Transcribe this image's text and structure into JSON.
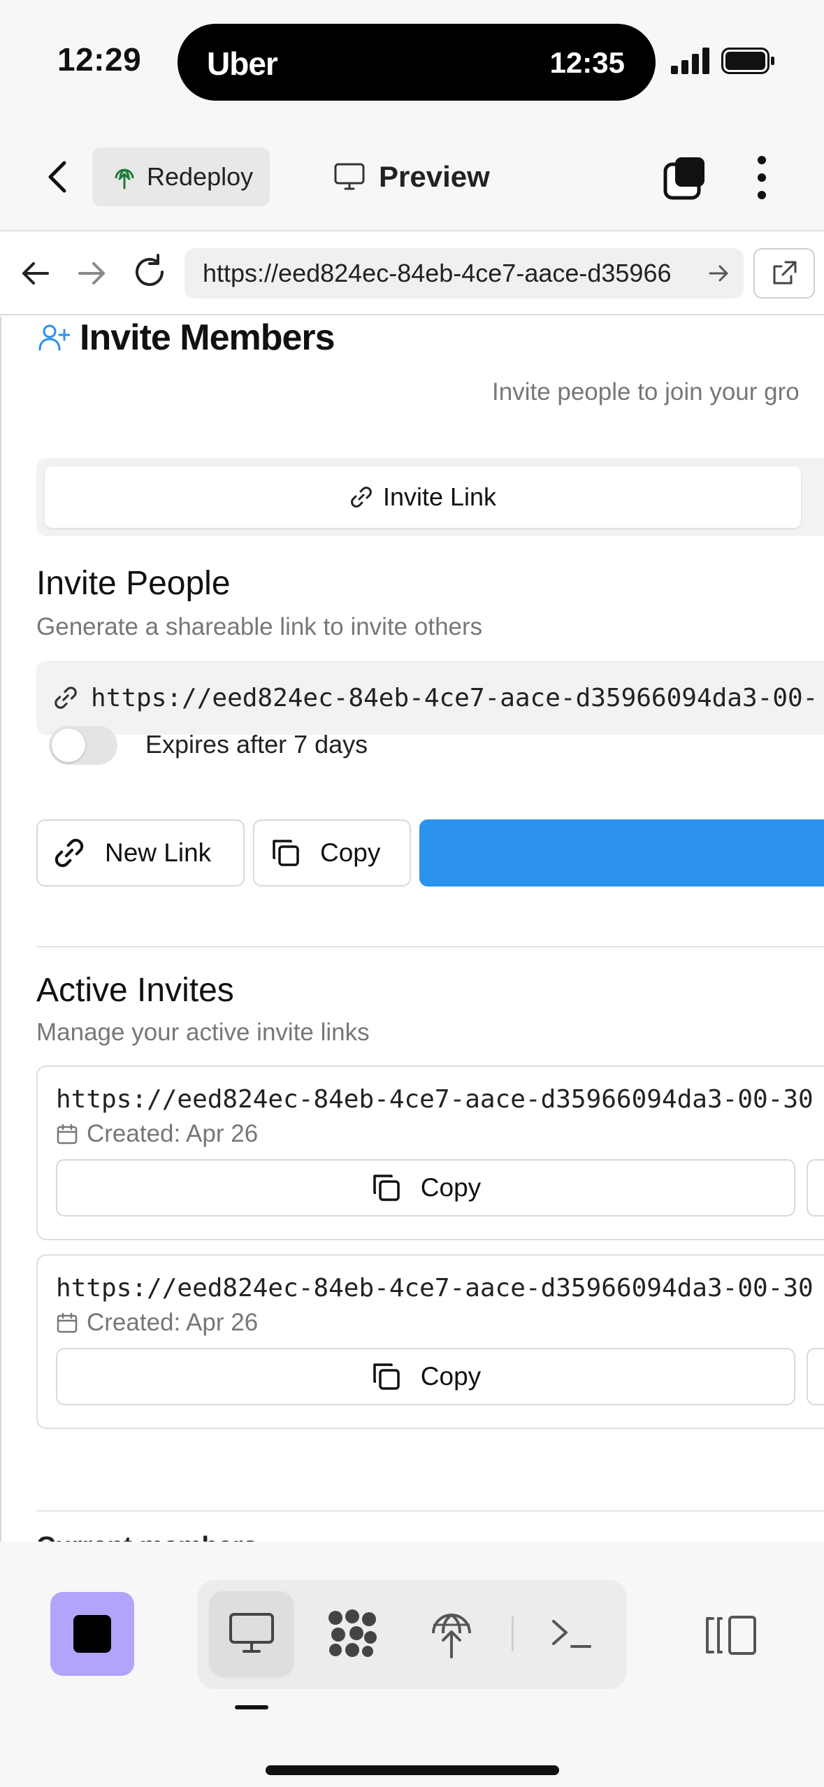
{
  "status_bar": {
    "time": "12:29",
    "island_app": "Uber",
    "island_time": "12:35"
  },
  "header": {
    "redeploy_label": "Redeploy",
    "preview_label": "Preview"
  },
  "browser": {
    "url": "https://eed824ec-84eb-4ce7-aace-d35966"
  },
  "page": {
    "title": "Invite Members",
    "subtitle": "Invite people to join your gro",
    "tab_invite_link": "Invite Link",
    "invite_people": {
      "title": "Invite People",
      "description": "Generate a shareable link to invite others",
      "link": "https://eed824ec-84eb-4ce7-aace-d35966094da3-00-",
      "toggle_label": "Expires after 7 days",
      "toggle_on": false,
      "new_link_label": "New Link",
      "copy_label": "Copy"
    },
    "active_invites": {
      "title": "Active Invites",
      "description": "Manage your active invite links",
      "items": [
        {
          "url": "https://eed824ec-84eb-4ce7-aace-d35966094da3-00-30",
          "created": "Created: Apr 26",
          "copy_label": "Copy"
        },
        {
          "url": "https://eed824ec-84eb-4ce7-aace-d35966094da3-00-30",
          "created": "Created: Apr 26",
          "copy_label": "Copy"
        }
      ]
    },
    "current_members_title": "Current members"
  },
  "colors": {
    "primary": "#2b93ee",
    "accent_icon": "#2b8ff0",
    "stop_button": "#b3a3fa",
    "redeploy_icon": "#1f7a3a"
  }
}
